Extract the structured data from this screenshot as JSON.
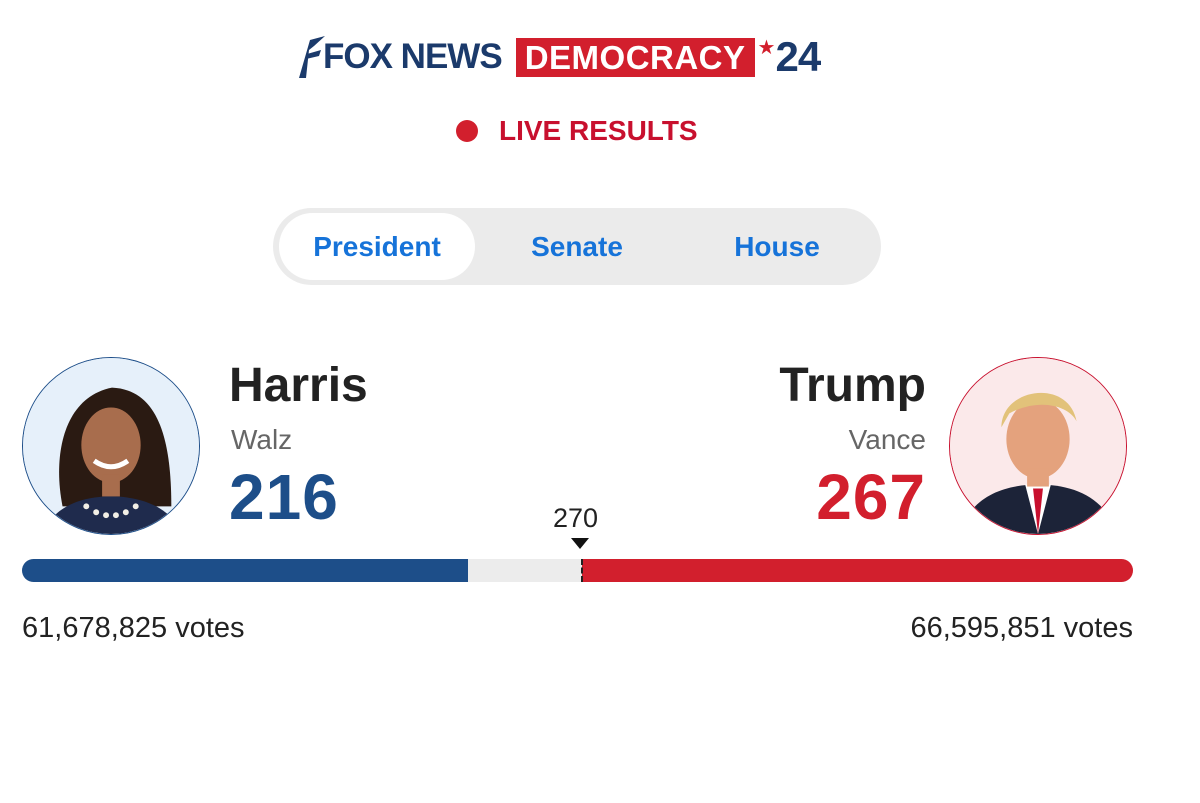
{
  "header": {
    "fox_news": "FOX NEWS",
    "democracy": "DEMOCRACY",
    "star": "★",
    "year": "24",
    "brand_red": "#d21f2d",
    "brand_navy": "#1b3a6b"
  },
  "live": {
    "label": "LIVE RESULTS",
    "dot_color": "#d21f2d"
  },
  "tabs": [
    {
      "label": "President",
      "active": true
    },
    {
      "label": "Senate",
      "active": false
    },
    {
      "label": "House",
      "active": false
    }
  ],
  "race": {
    "threshold": "270",
    "total_electoral_votes": 538,
    "left": {
      "name": "Harris",
      "running_mate": "Walz",
      "electoral_votes": "216",
      "popular_votes": "61,678,825 votes",
      "color": "#1d4e89"
    },
    "right": {
      "name": "Trump",
      "running_mate": "Vance",
      "electoral_votes": "267",
      "popular_votes": "66,595,851 votes",
      "color": "#d21f2d"
    }
  }
}
